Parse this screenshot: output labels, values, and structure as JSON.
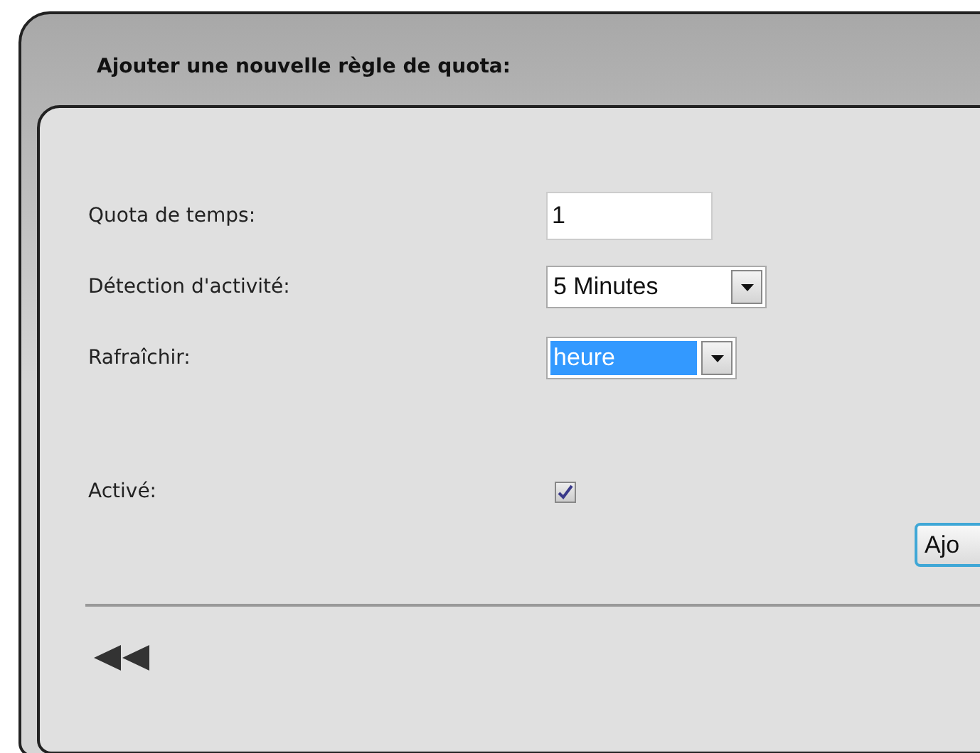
{
  "title": "Ajouter une nouvelle règle de quota:",
  "fields": [
    {
      "kind": "text",
      "label": "Quota de temps:",
      "value": "1"
    },
    {
      "kind": "select",
      "label": "Détection d'activité:",
      "value": "5 Minutes",
      "focused": false
    },
    {
      "kind": "select",
      "label": "Rafraîchir:",
      "value": "heure",
      "focused": true
    }
  ],
  "enabled": {
    "label": "Activé:",
    "checked": true
  },
  "add_button": "Ajo"
}
